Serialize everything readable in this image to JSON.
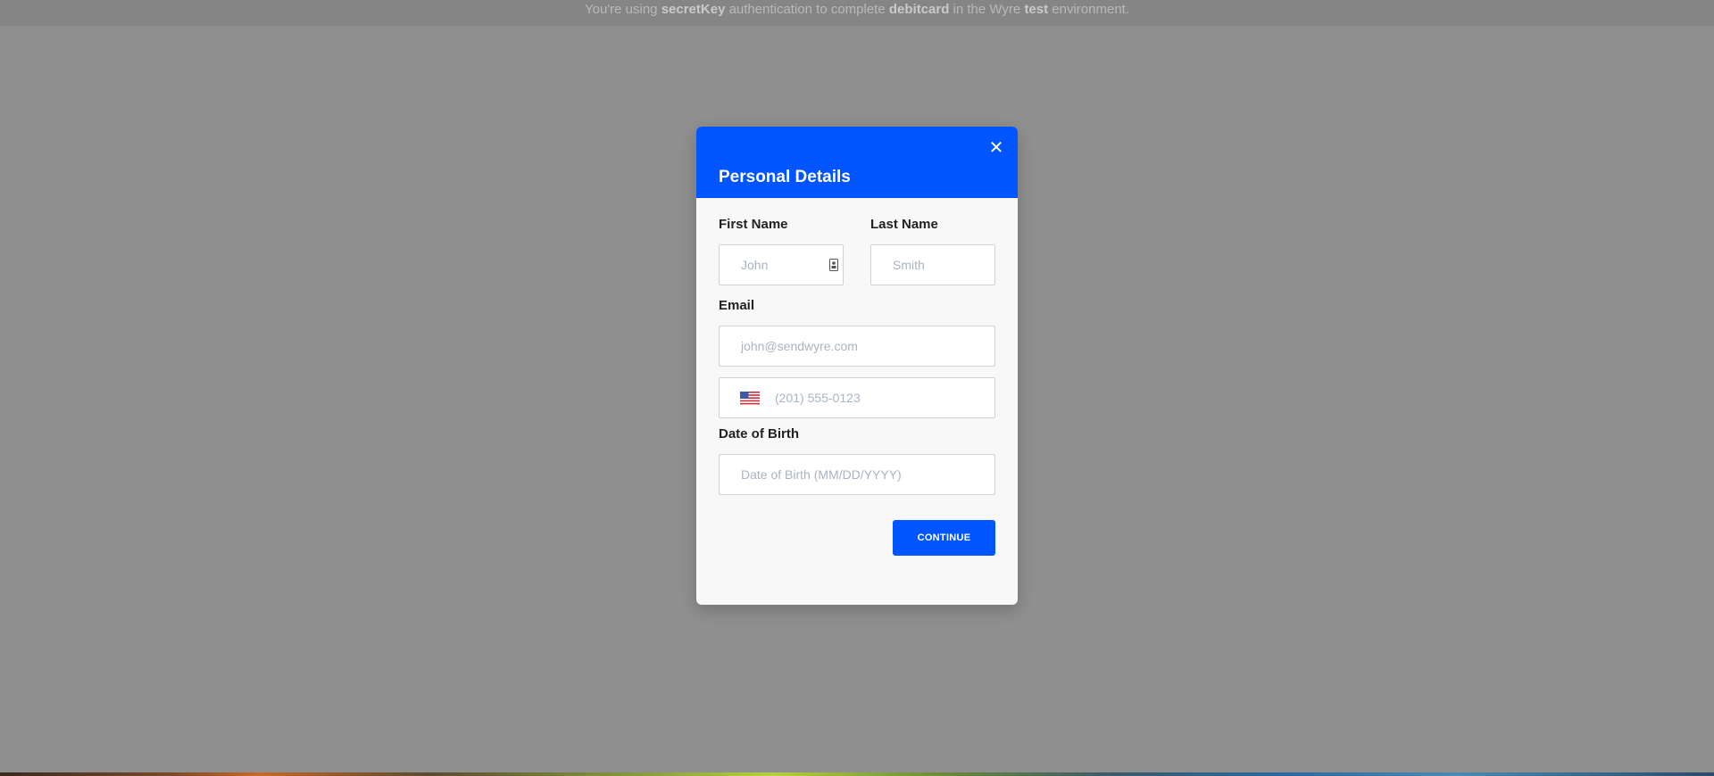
{
  "banner": {
    "prefix": "You're using ",
    "auth_method": "secretKey",
    "middle": " authentication to complete ",
    "flow": "debitcard",
    "middle2": " in the Wyre ",
    "environment": "test",
    "suffix": " environment."
  },
  "modal": {
    "title": "Personal Details",
    "close_icon": "close-icon",
    "fields": {
      "first_name": {
        "label": "First Name",
        "placeholder": "John",
        "value": ""
      },
      "last_name": {
        "label": "Last Name",
        "placeholder": "Smith",
        "value": ""
      },
      "email": {
        "label": "Email",
        "placeholder": "john@sendwyre.com",
        "value": ""
      },
      "phone": {
        "placeholder": "(201) 555-0123",
        "country_icon": "us-flag-icon",
        "value": ""
      },
      "dob": {
        "label": "Date of Birth",
        "placeholder": "Date of Birth (MM/DD/YYYY)",
        "value": ""
      }
    },
    "continue_label": "CONTINUE"
  },
  "colors": {
    "accent": "#0055ff",
    "overlay": "#8f8f8f"
  }
}
